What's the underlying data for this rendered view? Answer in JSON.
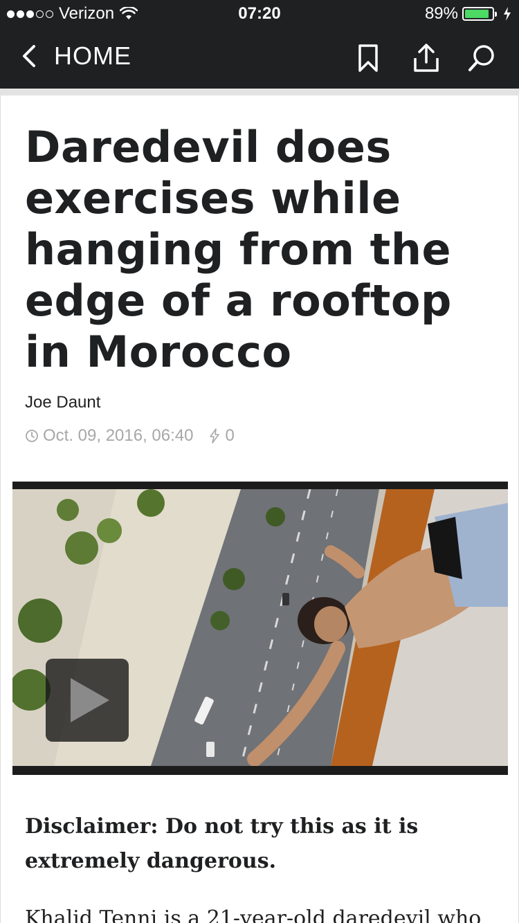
{
  "status_bar": {
    "carrier": "Verizon",
    "time": "07:20",
    "battery": "89%",
    "battery_level": 0.89,
    "signal_bars_filled": 3,
    "signal_bars_total": 5
  },
  "nav": {
    "back_label": "HOME",
    "icons": [
      "chevron-left-icon",
      "bookmark-icon",
      "share-icon",
      "search-icon"
    ]
  },
  "article": {
    "headline": "Daredevil does exercises while hanging from the edge of a rooftop in Morocco",
    "author": "Joe Daunt",
    "date": "Oct. 09, 2016, 06:40",
    "reactions": "0",
    "disclaimer": "Disclaimer: Do not try this as it is extremely dangerous.",
    "body_preview": "Khalid Tenni is a 21-year-old daredevil who"
  },
  "colors": {
    "header_bg": "#1f2022",
    "battery_green": "#4cd964",
    "meta_gray": "#a7a7a7"
  }
}
